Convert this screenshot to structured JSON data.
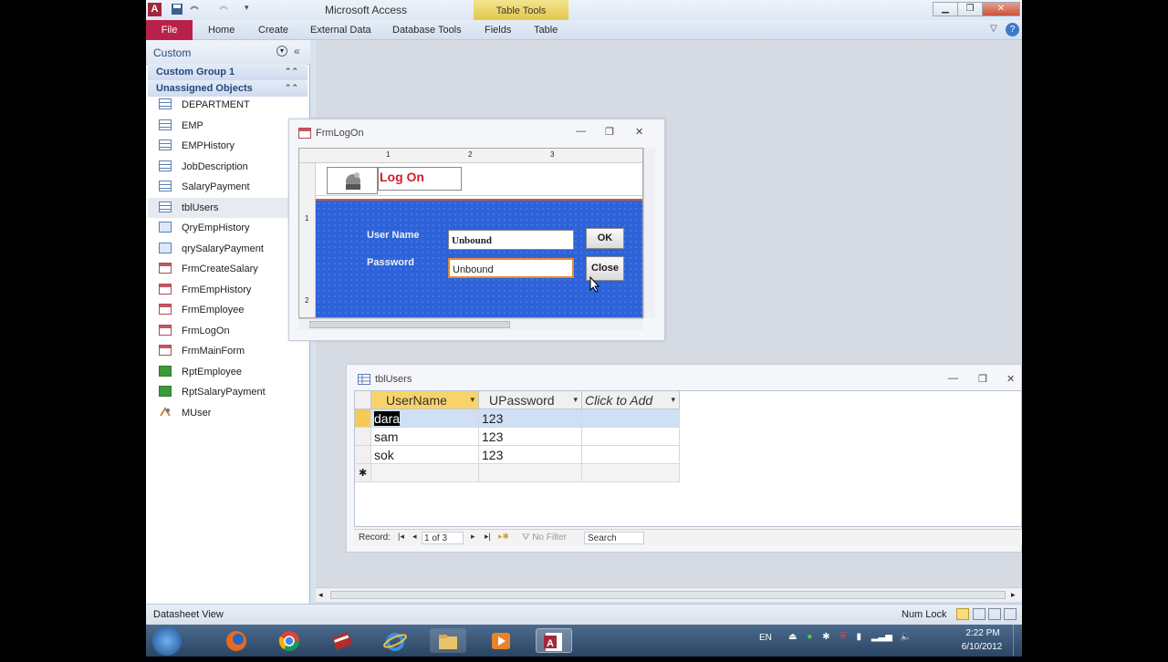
{
  "app": {
    "title": "Microsoft Access",
    "contextual_tab_group": "Table Tools"
  },
  "ribbon": {
    "tabs": [
      "File",
      "Home",
      "Create",
      "External Data",
      "Database Tools",
      "Fields",
      "Table"
    ]
  },
  "nav_pane": {
    "title": "Custom",
    "groups": [
      {
        "label": "Custom Group 1"
      },
      {
        "label": "Unassigned Objects"
      }
    ],
    "items": [
      {
        "label": "DEPARTMENT",
        "icon": "table-icon"
      },
      {
        "label": "EMP",
        "icon": "table-icon"
      },
      {
        "label": "EMPHistory",
        "icon": "table-icon"
      },
      {
        "label": "JobDescription",
        "icon": "table-icon"
      },
      {
        "label": "SalaryPayment",
        "icon": "table-icon"
      },
      {
        "label": "tblUsers",
        "icon": "table-icon"
      },
      {
        "label": "QryEmpHistory",
        "icon": "query-icon"
      },
      {
        "label": "qrySalaryPayment",
        "icon": "query-icon"
      },
      {
        "label": "FrmCreateSalary",
        "icon": "form-icon"
      },
      {
        "label": "FrmEmpHistory",
        "icon": "form-icon"
      },
      {
        "label": "FrmEmployee",
        "icon": "form-icon"
      },
      {
        "label": "FrmLogOn",
        "icon": "form-icon"
      },
      {
        "label": "FrmMainForm",
        "icon": "form-icon"
      },
      {
        "label": "RptEmployee",
        "icon": "report-icon"
      },
      {
        "label": "RptSalaryPayment",
        "icon": "report-icon"
      },
      {
        "label": "MUser",
        "icon": "module-icon"
      }
    ]
  },
  "form_window": {
    "title": "FrmLogOn",
    "header_title": "Log On",
    "ruler_marks": [
      "1",
      "2",
      "3"
    ],
    "ruler_left_marks": [
      "1",
      "2"
    ],
    "user_label": "User Name",
    "password_label": "Password",
    "user_value": "Unbound",
    "password_value": "Unbound",
    "ok_button": "OK",
    "close_button": "Close"
  },
  "datasheet_window": {
    "title": "tblUsers",
    "columns": [
      "UserName",
      "UPassword",
      "Click to Add"
    ],
    "rows": [
      {
        "UserName": "dara",
        "UPassword": "123"
      },
      {
        "UserName": "sam",
        "UPassword": "123"
      },
      {
        "UserName": "sok",
        "UPassword": "123"
      }
    ],
    "new_record_marker": "✱",
    "record_label": "Record:",
    "record_position": "1 of 3",
    "filter_label": "No Filter",
    "search_label": "Search"
  },
  "status_bar": {
    "view": "Datasheet View",
    "num_lock": "Num Lock"
  },
  "taskbar": {
    "lang": "EN",
    "time": "2:22 PM",
    "date": "6/10/2012",
    "apps": [
      "start-orb",
      "firefox",
      "chrome",
      "book-app",
      "internet-explorer",
      "file-explorer",
      "media-player",
      "access"
    ]
  },
  "colors": {
    "file_tab": "#b8224a",
    "form_detail": "#2e62d9",
    "title_red": "#d0202a",
    "selection": "#000000"
  }
}
